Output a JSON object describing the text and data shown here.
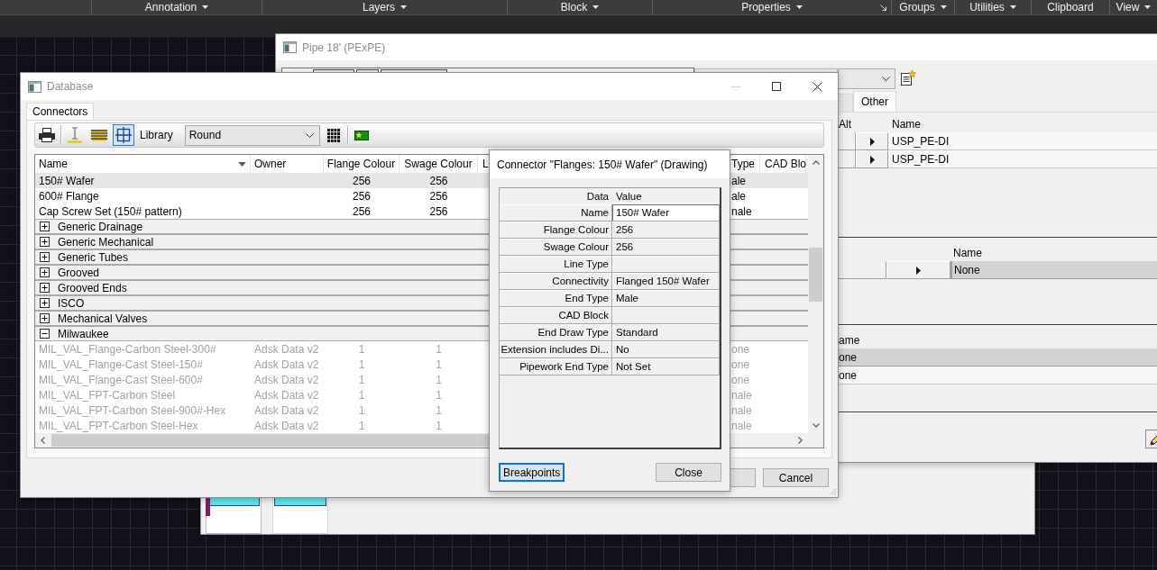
{
  "ribbon": {
    "panels": [
      {
        "label": "Annotation",
        "dropdown": true,
        "launcher": false
      },
      {
        "label": "Layers",
        "dropdown": true,
        "launcher": false
      },
      {
        "label": "Block",
        "dropdown": true,
        "launcher": false
      },
      {
        "label": "Properties",
        "dropdown": true,
        "launcher": true
      },
      {
        "label": "Groups",
        "dropdown": true,
        "launcher": false
      },
      {
        "label": "Utilities",
        "dropdown": true,
        "launcher": false
      },
      {
        "label": "Clipboard",
        "dropdown": false,
        "launcher": false
      },
      {
        "label": "View",
        "dropdown": true,
        "launcher": false
      }
    ]
  },
  "background_window": {
    "preview_tiles": [
      {
        "selected": true
      },
      {
        "selected": false
      }
    ]
  },
  "pipe_window": {
    "title": "Pipe 18' (PExPE)",
    "active": false,
    "tabs": [
      {
        "selected": false
      },
      {
        "label": "Other",
        "selected": true
      }
    ],
    "alt_table": {
      "columns": [
        "Alt",
        "Name"
      ],
      "rows": [
        {
          "name": "USP_PE-DI",
          "selected": false
        },
        {
          "name": "USP_PE-DI",
          "selected": false
        }
      ]
    },
    "table_2": {
      "columns": [
        "Name"
      ],
      "rows": [
        {
          "name": "None",
          "selected": true
        }
      ]
    },
    "table_3": {
      "columns": [
        "ame"
      ],
      "rows": [
        {
          "name": "one",
          "selected": true
        },
        {
          "name": "one",
          "selected": false
        }
      ]
    }
  },
  "database_window": {
    "title": "Database",
    "active": false,
    "tabs": [
      {
        "label": "Connectors",
        "selected": true
      }
    ],
    "toolbar": [
      {
        "kind": "button",
        "pressed": false
      },
      {
        "kind": "separator"
      },
      {
        "kind": "button",
        "pressed": false
      },
      {
        "kind": "button",
        "pressed": false
      },
      {
        "kind": "button",
        "pressed": true
      },
      {
        "kind": "label",
        "text": "Library"
      },
      {
        "kind": "combo",
        "value": "Round"
      },
      {
        "kind": "button",
        "pressed": false
      },
      {
        "kind": "separator"
      },
      {
        "kind": "button",
        "pressed": false
      }
    ],
    "table": {
      "columns": [
        {
          "label": "Name",
          "sorted": true
        },
        {
          "label": "Owner",
          "sorted": false
        },
        {
          "label": "Flange Colour",
          "sorted": false
        },
        {
          "label": "Swage Colour",
          "sorted": false
        },
        {
          "label": "L",
          "sorted": false
        },
        {
          "label": "Type",
          "sorted": false
        },
        {
          "label": "CAD Blo",
          "sorted": false
        }
      ],
      "rows": [
        {
          "kind": "item",
          "selected": true,
          "disabled": false,
          "name": "150# Wafer",
          "flange_colour": "256",
          "swage_colour": "256",
          "type": "ale"
        },
        {
          "kind": "item",
          "selected": false,
          "disabled": false,
          "name": "600# Flange",
          "flange_colour": "256",
          "swage_colour": "256",
          "type": "ale"
        },
        {
          "kind": "item",
          "selected": false,
          "disabled": false,
          "name": "Cap Screw Set (150# pattern)",
          "flange_colour": "256",
          "swage_colour": "256",
          "type": "nale"
        },
        {
          "kind": "group",
          "label": "Generic Drainage",
          "expanded": false,
          "selected": false
        },
        {
          "kind": "group",
          "label": "Generic Mechanical",
          "expanded": false,
          "selected": false
        },
        {
          "kind": "group",
          "label": "Generic Tubes",
          "expanded": false,
          "selected": false
        },
        {
          "kind": "group",
          "label": "Grooved",
          "expanded": false,
          "selected": false
        },
        {
          "kind": "group",
          "label": "Grooved Ends",
          "expanded": false,
          "selected": false
        },
        {
          "kind": "group",
          "label": "ISCO",
          "expanded": false,
          "selected": false
        },
        {
          "kind": "group",
          "label": "Mechanical Valves",
          "expanded": false,
          "selected": false
        },
        {
          "kind": "group",
          "label": "Milwaukee",
          "expanded": true,
          "selected": false,
          "children": [
            {
              "kind": "item",
              "selected": false,
              "disabled": true,
              "name": "MIL_VAL_Flange-Carbon Steel-300#",
              "owner": "Adsk Data v2",
              "flange_colour": "1",
              "swage_colour": "1",
              "type": "one"
            },
            {
              "kind": "item",
              "selected": false,
              "disabled": true,
              "name": "MIL_VAL_Flange-Cast Steel-150#",
              "owner": "Adsk Data v2",
              "flange_colour": "1",
              "swage_colour": "1",
              "type": "one"
            },
            {
              "kind": "item",
              "selected": false,
              "disabled": true,
              "name": "MIL_VAL_Flange-Cast Steel-600#",
              "owner": "Adsk Data v2",
              "flange_colour": "1",
              "swage_colour": "1",
              "type": "one"
            },
            {
              "kind": "item",
              "selected": false,
              "disabled": true,
              "name": "MIL_VAL_FPT-Carbon Steel",
              "owner": "Adsk Data v2",
              "flange_colour": "1",
              "swage_colour": "1",
              "type": "nale"
            },
            {
              "kind": "item",
              "selected": false,
              "disabled": true,
              "name": "MIL_VAL_FPT-Carbon Steel-900#-Hex",
              "owner": "Adsk Data v2",
              "flange_colour": "1",
              "swage_colour": "1",
              "type": "nale"
            },
            {
              "kind": "item",
              "selected": false,
              "disabled": true,
              "name": "MIL_VAL_FPT-Carbon Steel-Hex",
              "owner": "Adsk Data v2",
              "flange_colour": "1",
              "swage_colour": "1",
              "type": "nale"
            }
          ]
        }
      ]
    },
    "buttons": [
      {
        "label": "Cancel"
      }
    ]
  },
  "connector_dialog": {
    "title": "Connector \"Flanges: 150# Wafer\" (Drawing)",
    "active": true,
    "header": {
      "data": "Data",
      "value": "Value"
    },
    "properties": [
      {
        "label": "Name",
        "value": "150# Wafer",
        "editing": true
      },
      {
        "label": "Flange Colour",
        "value": "256",
        "editing": false
      },
      {
        "label": "Swage Colour",
        "value": "256",
        "editing": false
      },
      {
        "label": "Line Type",
        "editing": false
      },
      {
        "label": "Connectivity",
        "value": "Flanged 150# Wafer",
        "editing": false
      },
      {
        "label": "End Type",
        "value": "Male",
        "editing": false
      },
      {
        "label": "CAD Block",
        "editing": false
      },
      {
        "label": "End Draw Type",
        "value": "Standard",
        "editing": false
      },
      {
        "label": "Extension includes Di...",
        "value": "No",
        "editing": false
      },
      {
        "label": "Pipework End Type",
        "value": "Not Set",
        "editing": false
      }
    ],
    "buttons": [
      {
        "label": "Breakpoints",
        "focused": true
      },
      {
        "label": "Close",
        "focused": false
      }
    ]
  }
}
